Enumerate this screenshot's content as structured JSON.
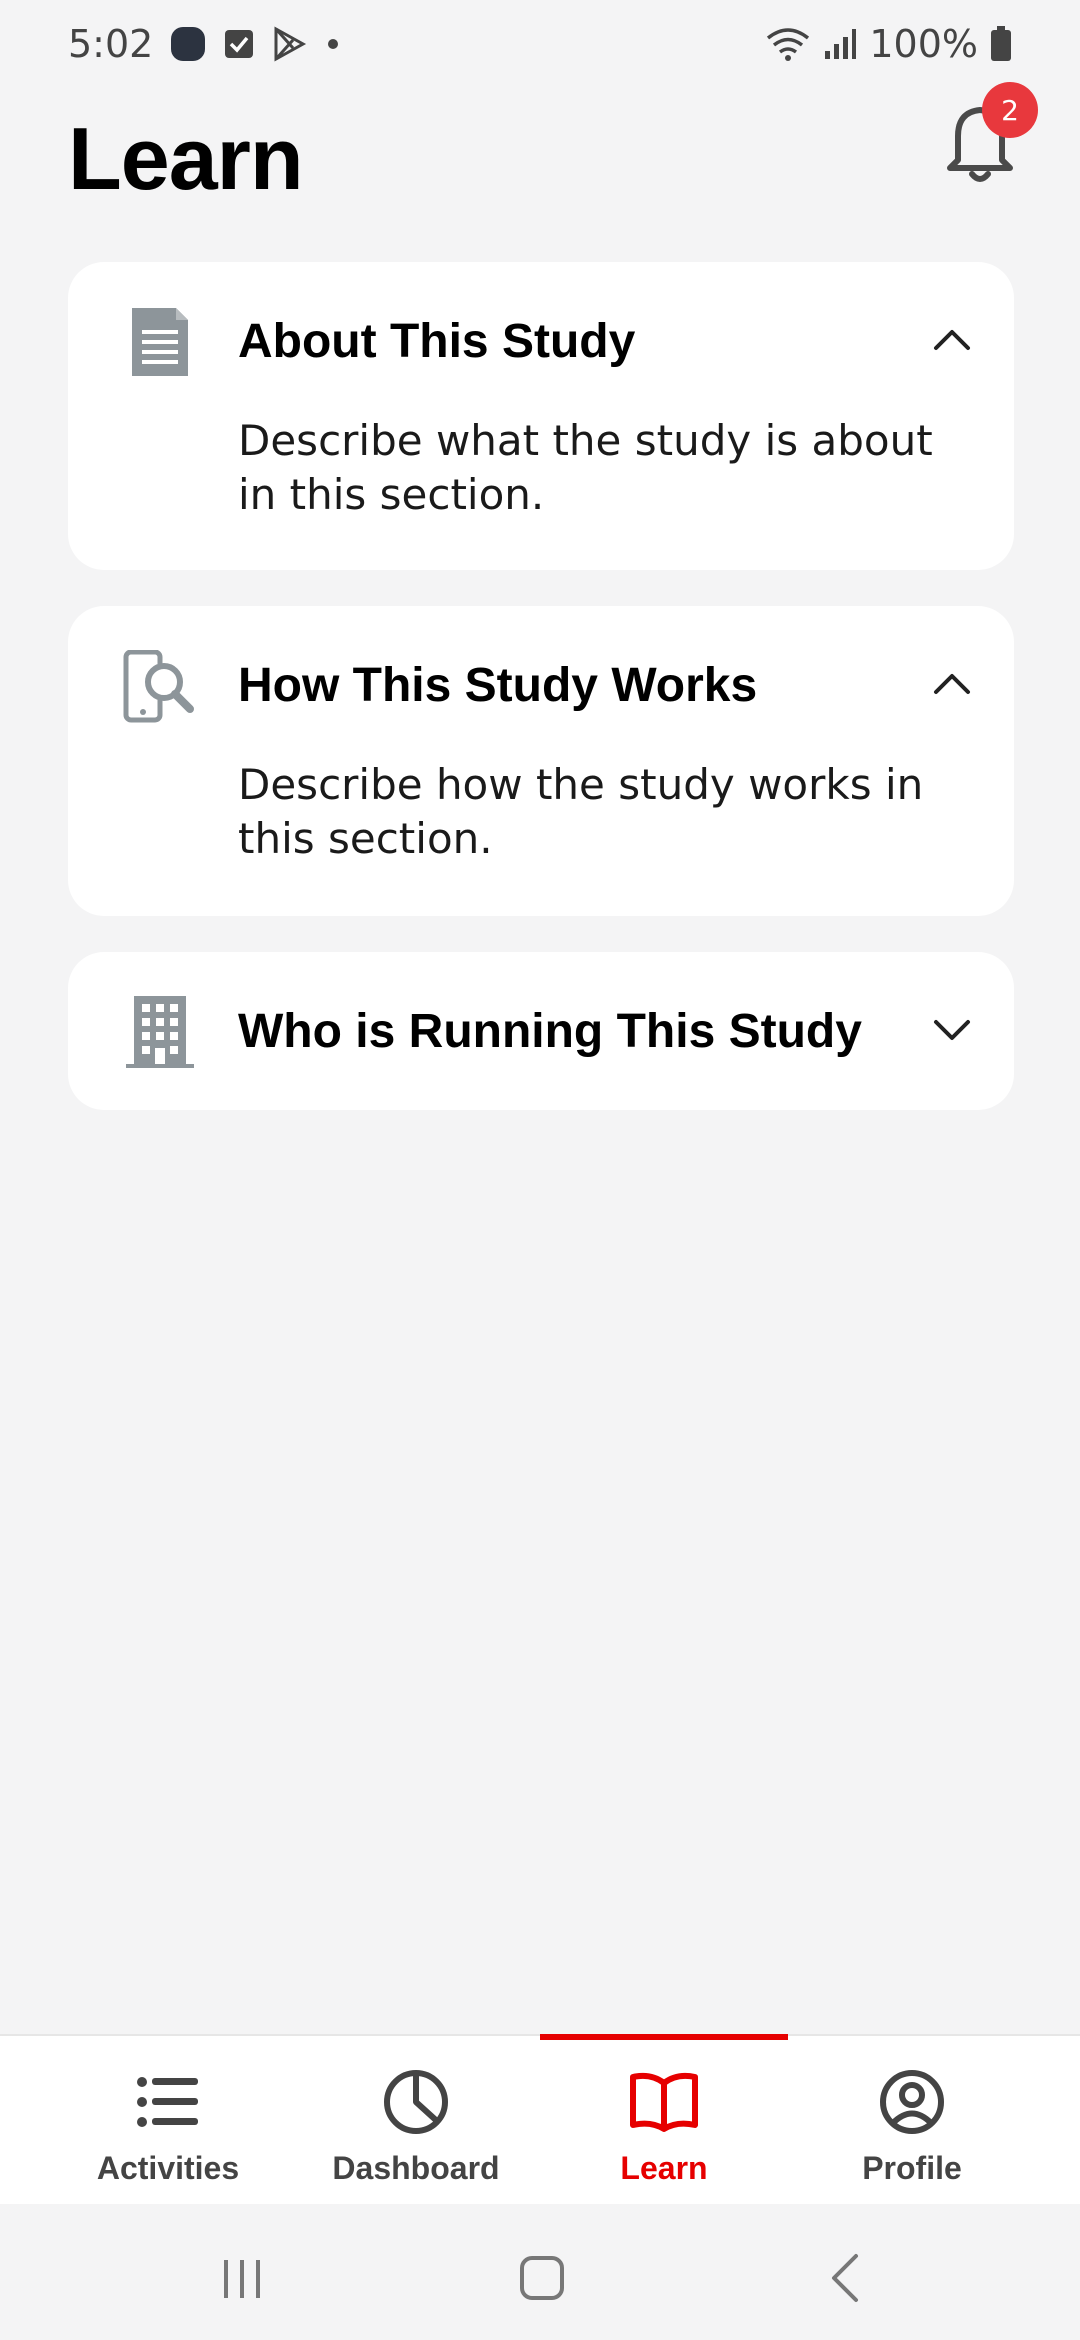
{
  "status_bar": {
    "time": "5:02",
    "battery": "100%"
  },
  "header": {
    "title": "Learn",
    "notification_count": "2"
  },
  "cards": [
    {
      "title": "About This Study",
      "body": "Describe what the study is about in this section.",
      "expanded": true,
      "icon": "document-icon"
    },
    {
      "title": "How This Study Works",
      "body": "Describe how the study works in this section.",
      "expanded": true,
      "icon": "phone-search-icon"
    },
    {
      "title": "Who is Running This Study",
      "body": "",
      "expanded": false,
      "icon": "building-icon"
    }
  ],
  "bottom_nav": {
    "items": [
      {
        "label": "Activities",
        "icon": "list-icon",
        "active": false
      },
      {
        "label": "Dashboard",
        "icon": "pie-chart-icon",
        "active": false
      },
      {
        "label": "Learn",
        "icon": "book-icon",
        "active": true
      },
      {
        "label": "Profile",
        "icon": "user-circle-icon",
        "active": false
      }
    ]
  },
  "colors": {
    "accent": "#e60000",
    "badge": "#e8383d",
    "icon_gray": "#8d959a",
    "background": "#f4f4f5"
  }
}
